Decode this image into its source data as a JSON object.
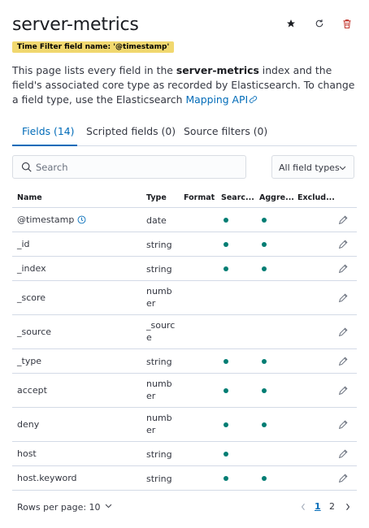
{
  "header": {
    "title": "server-metrics",
    "time_filter_badge": "Time Filter field name: '@timestamp'",
    "icons": {
      "star": "star-icon",
      "refresh": "refresh-icon",
      "delete": "trash-icon"
    }
  },
  "description": {
    "part1": "This page lists every field in the ",
    "index_name": "server-metrics",
    "part2": " index and the field's associated core type as recorded by Elasticsearch. To change a field type, use the Elasticsearch ",
    "link": "Mapping API"
  },
  "tabs": [
    {
      "label": "Fields (14)",
      "active": true
    },
    {
      "label": "Scripted fields (0)",
      "active": false
    },
    {
      "label": "Source filters (0)",
      "active": false
    }
  ],
  "search": {
    "placeholder": "Search",
    "value": ""
  },
  "type_filter": {
    "selected": "All field types"
  },
  "table": {
    "columns": [
      "Name",
      "Type",
      "Format",
      "Searc...",
      "Aggre...",
      "Exclud..."
    ],
    "rows": [
      {
        "name": "@timestamp",
        "type": "date",
        "searchable": true,
        "aggregatable": true,
        "time_field": true
      },
      {
        "name": "_id",
        "type": "string",
        "searchable": true,
        "aggregatable": true
      },
      {
        "name": "_index",
        "type": "string",
        "searchable": true,
        "aggregatable": true
      },
      {
        "name": "_score",
        "type": "number",
        "searchable": false,
        "aggregatable": false
      },
      {
        "name": "_source",
        "type": "_source",
        "searchable": false,
        "aggregatable": false
      },
      {
        "name": "_type",
        "type": "string",
        "searchable": true,
        "aggregatable": true
      },
      {
        "name": "accept",
        "type": "number",
        "searchable": true,
        "aggregatable": true
      },
      {
        "name": "deny",
        "type": "number",
        "searchable": true,
        "aggregatable": true
      },
      {
        "name": "host",
        "type": "string",
        "searchable": true,
        "aggregatable": false
      },
      {
        "name": "host.keyword",
        "type": "string",
        "searchable": true,
        "aggregatable": true
      }
    ]
  },
  "footer": {
    "rows_per_page": "Rows per page: 10",
    "pages": [
      "1",
      "2"
    ],
    "current_page": "1"
  },
  "colors": {
    "accent": "#006bb8",
    "badge": "#f1d86f",
    "dot": "#017d73",
    "delete": "#bd271e"
  }
}
